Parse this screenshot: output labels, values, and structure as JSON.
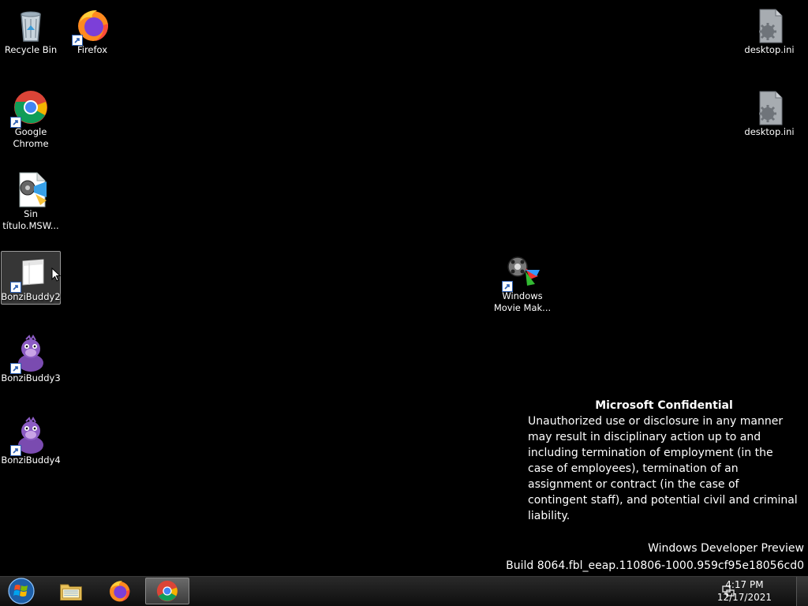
{
  "desktop": {
    "icons": {
      "recycle_bin": "Recycle Bin",
      "firefox": "Firefox",
      "chrome": "Google\nChrome",
      "sin_titulo": "Sin\ntítulo.MSW...",
      "bonzibuddy2": "BonziBuddy2",
      "bonzibuddy3": "BonziBuddy3",
      "bonzibuddy4": "BonziBuddy4",
      "movie_maker": "Windows\nMovie Mak...",
      "desktop_ini_1": "desktop.ini",
      "desktop_ini_2": "desktop.ini"
    },
    "selected_icon": "BonziBuddy2"
  },
  "watermark": {
    "title": "Microsoft Confidential",
    "body": "Unauthorized use or disclosure in any manner may result in disciplinary action up to and including termination of employment (in the case of employees), termination of an assignment or contract (in the case of contingent staff), and potential civil and criminal liability.",
    "product": "Windows Developer Preview",
    "build": "Build 8064.fbl_eeap.110806-1000.959cf95e18056cd0"
  },
  "taskbar": {
    "pinned": [
      "start-orb-icon",
      "file-explorer-icon",
      "firefox-icon",
      "chrome-icon"
    ],
    "active_app": "Google Chrome",
    "clock": {
      "time": "4:17 PM",
      "date": "12/17/2021"
    }
  },
  "colors": {
    "desktop_bg": "#000000",
    "taskbar_bg": "#1b1b1b"
  }
}
